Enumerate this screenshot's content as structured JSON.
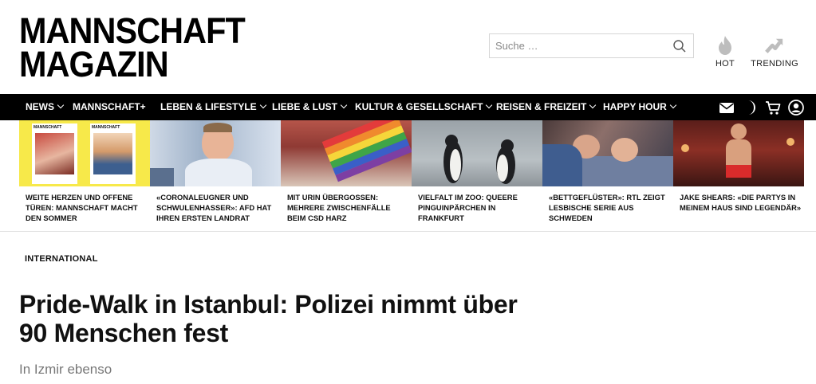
{
  "brand": {
    "line1": "MANNSCHAFT",
    "line2": "MAGAZIN"
  },
  "search": {
    "placeholder": "Suche …"
  },
  "header_links": {
    "hot": "HOT",
    "trending": "TRENDING"
  },
  "nav": {
    "items": [
      {
        "label": "NEWS",
        "has_dropdown": true
      },
      {
        "label": "MANNSCHAFT+",
        "has_dropdown": false
      },
      {
        "label": "LEBEN & LIFESTYLE",
        "has_dropdown": true
      },
      {
        "label": "LIEBE & LUST",
        "has_dropdown": true
      },
      {
        "label": "KULTUR & GESELLSCHAFT",
        "has_dropdown": true
      },
      {
        "label": "REISEN & FREIZEIT",
        "has_dropdown": true
      },
      {
        "label": "HAPPY HOUR",
        "has_dropdown": true
      }
    ],
    "icons": [
      "mail-icon",
      "dark-mode-icon",
      "cart-icon",
      "account-icon"
    ]
  },
  "teasers": [
    {
      "title": "WEITE HERZEN UND OFFENE TÜREN: MANNSCHAFT MACHT DEN SOMMER",
      "thumb_label": "MANNSCHAFT"
    },
    {
      "title": "«CORONALEUGNER UND SCHWULENHASSER»: AFD HAT IHREN ERSTEN LANDRAT"
    },
    {
      "title": "MIT URIN ÜBERGOSSEN: MEHRERE ZWISCHENFÄLLE BEIM CSD HARZ"
    },
    {
      "title": "VIELFALT IM ZOO: QUEERE PINGUINPÄRCHEN IN FRANKFURT"
    },
    {
      "title": "«BETTGEFLÜSTER»: RTL ZEIGT LESBISCHE SERIE AUS SCHWEDEN"
    },
    {
      "title": "JAKE SHEARS: «DIE PARTYS IN MEINEM HAUS SIND LEGENDÄR»"
    }
  ],
  "article": {
    "category": "INTERNATIONAL",
    "headline": "Pride-Walk in Istanbul: Polizei nimmt über 90 Menschen fest",
    "subline": "In Izmir ebenso"
  },
  "colors": {
    "nav_bg": "#000000",
    "magazine_yellow": "#f7e94a",
    "text": "#111111",
    "muted": "#777777"
  }
}
